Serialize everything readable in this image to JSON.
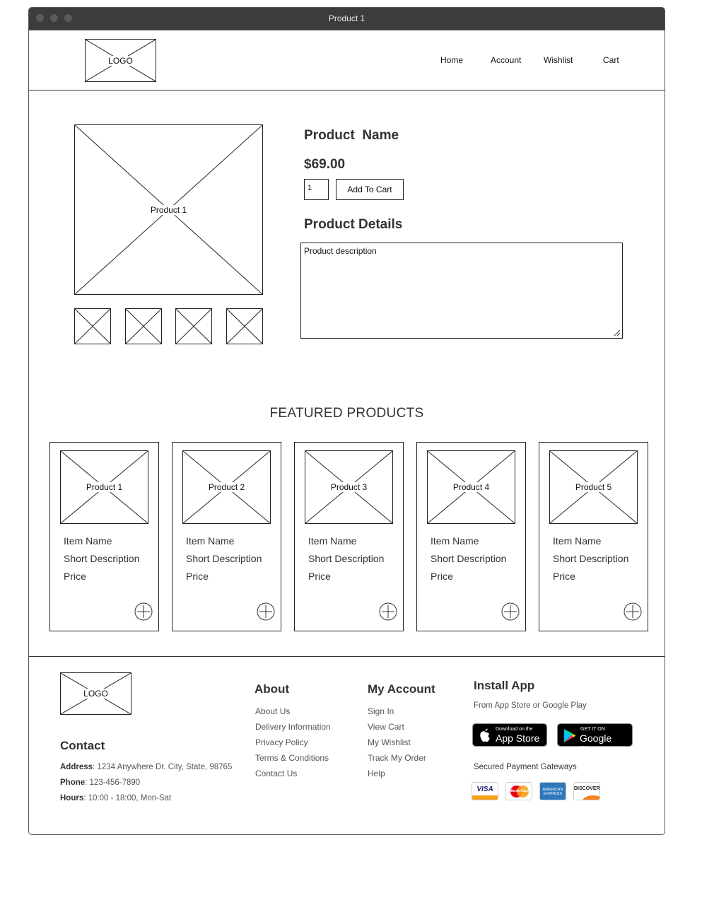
{
  "window": {
    "title": "Product 1"
  },
  "header": {
    "logo_label": "LOGO",
    "nav": [
      "Home",
      "Account",
      "Wishlist",
      "Cart"
    ]
  },
  "product": {
    "image_label": "Product 1",
    "name": "Product  Name",
    "price": "$69.00",
    "quantity": "1",
    "add_to_cart_label": "Add To Cart",
    "details_heading": "Product Details",
    "description": "Product description"
  },
  "featured": {
    "heading": "FEATURED PRODUCTS",
    "items": [
      {
        "image_label": "Product 1",
        "name": "Item Name",
        "description": "Short Description",
        "price": "Price"
      },
      {
        "image_label": "Product 2",
        "name": "Item Name",
        "description": "Short Description",
        "price": "Price"
      },
      {
        "image_label": "Product 3",
        "name": "Item Name",
        "description": "Short Description",
        "price": "Price"
      },
      {
        "image_label": "Product 4",
        "name": "Item Name",
        "description": "Short Description",
        "price": "Price"
      },
      {
        "image_label": "Product 5",
        "name": "Item Name",
        "description": "Short Description",
        "price": "Price"
      }
    ]
  },
  "footer": {
    "logo_label": "LOGO",
    "contact": {
      "heading": "Contact",
      "address_label": "Address",
      "address": ": 1234 Anywhere Dr. City, State, 98765",
      "phone_label": "Phone",
      "phone": ": 123-456-7890",
      "hours_label": "Hours",
      "hours": ": 10:00 - 18:00, Mon-Sat"
    },
    "about": {
      "heading": "About",
      "links": [
        "About Us",
        "Delivery Information",
        "Privacy Policy",
        "Terms & Conditions",
        "Contact Us"
      ]
    },
    "account": {
      "heading": "My Account",
      "links": [
        "Sign In",
        "View Cart",
        "My Wishlist",
        "Track My Order",
        "Help"
      ]
    },
    "app": {
      "heading": "Install App",
      "subtitle": "From App Store or Google Play",
      "app_store_small": "Download on the",
      "app_store_big": "App Store",
      "google_play_small": "GET IT ON",
      "google_play_big": "Google Play",
      "payment_heading": "Secured Payment Gateways",
      "payment_methods": [
        "VISA",
        "MasterCard",
        "AMERICAN EXPRESS",
        "DISCOVER"
      ]
    }
  }
}
